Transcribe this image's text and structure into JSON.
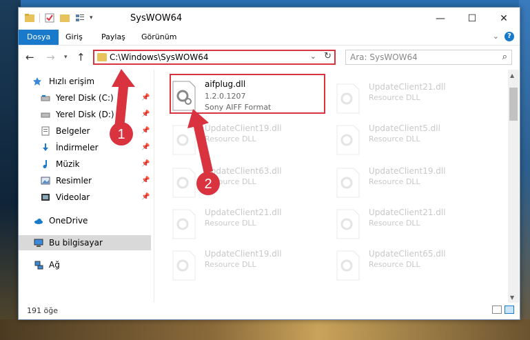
{
  "window": {
    "title": "SysWOW64",
    "controls": {
      "minimize": "—",
      "maximize": "☐",
      "close": "✕"
    }
  },
  "ribbon": {
    "tabs": [
      "Dosya",
      "Giriş",
      "Paylaş",
      "Görünüm"
    ],
    "active_tab": "Dosya",
    "help": "?"
  },
  "address": {
    "path": "C:\\Windows\\SysWOW64",
    "search_placeholder": "Ara: SysWOW64"
  },
  "nav": {
    "quick_access": "Hızlı erişim",
    "items": [
      {
        "label": "Yerel Disk (C:)",
        "icon": "drive-icon",
        "pinned": true
      },
      {
        "label": "Yerel Disk (D:)",
        "icon": "drive-icon",
        "pinned": true
      },
      {
        "label": "Belgeler",
        "icon": "documents-icon",
        "pinned": true
      },
      {
        "label": "İndirmeler",
        "icon": "downloads-icon",
        "pinned": true
      },
      {
        "label": "Müzik",
        "icon": "music-icon",
        "pinned": true
      },
      {
        "label": "Resimler",
        "icon": "pictures-icon",
        "pinned": true
      },
      {
        "label": "Videolar",
        "icon": "videos-icon",
        "pinned": true
      }
    ],
    "onedrive": "OneDrive",
    "this_pc": "Bu bilgisayar",
    "network": "Ağ"
  },
  "files": {
    "highlighted": {
      "name": "aifplug.dll",
      "version": "1.2.0.1207",
      "description": "Sony AIFF Format"
    },
    "left_column": [
      {
        "name": "UpdateClient19.dll",
        "type": "Resource DLL"
      },
      {
        "name": "UpdateClient63.dll",
        "type": "Resource DLL"
      },
      {
        "name": "UpdateClient21.dll",
        "type": "Resource DLL"
      },
      {
        "name": "UpdateClient19.dll",
        "type": "Resource DLL"
      }
    ],
    "right_column": [
      {
        "name": "UpdateClient21.dll",
        "type": "Resource DLL"
      },
      {
        "name": "UpdateClient5.dll",
        "type": "Resource DLL"
      },
      {
        "name": "UpdateClient19.dll",
        "type": "Resource DLL"
      },
      {
        "name": "UpdateClient21.dll",
        "type": "Resource DLL"
      },
      {
        "name": "UpdateClient65.dll",
        "type": "Resource DLL"
      }
    ]
  },
  "status": {
    "count": "191 öğe"
  },
  "annotations": {
    "step1": "1",
    "step2": "2",
    "color": "#d9333f"
  }
}
